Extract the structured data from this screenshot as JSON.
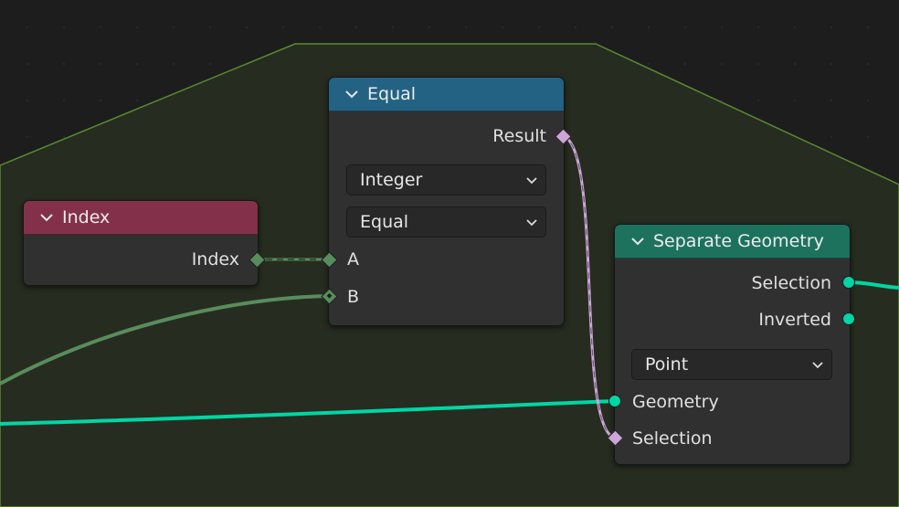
{
  "nodes": {
    "index": {
      "title": "Index",
      "header_color": "#83314a",
      "output_label": "Index"
    },
    "equal": {
      "title": "Equal",
      "header_color": "#246283",
      "output_label": "Result",
      "data_type": "Integer",
      "operation": "Equal",
      "input_a_label": "A",
      "input_b_label": "B"
    },
    "separate_geometry": {
      "title": "Separate Geometry",
      "header_color": "#1d725e",
      "output_selection_label": "Selection",
      "output_inverted_label": "Inverted",
      "domain": "Point",
      "input_geometry_label": "Geometry",
      "input_selection_label": "Selection"
    }
  },
  "colors": {
    "background": "#1d1d1d",
    "frame_fill": "#262c20",
    "frame_border": "#5a8a32",
    "socket_integer": "#598c5c",
    "socket_boolean": "#cca6d6",
    "socket_geometry": "#00d6a3"
  },
  "icons": {
    "collapse": "chevron-down-icon",
    "dropdown": "chevron-down-icon"
  }
}
